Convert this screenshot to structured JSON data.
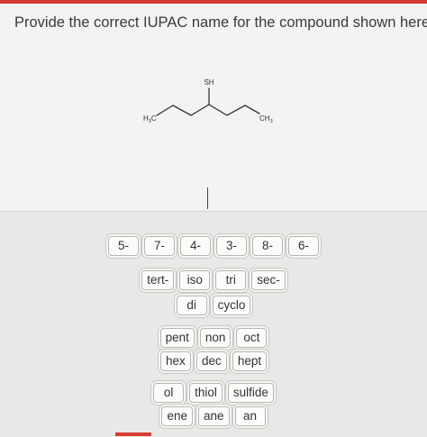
{
  "question": {
    "prompt": "Provide the correct IUPAC name for the compound shown here."
  },
  "molecule": {
    "labels": {
      "thiol_group": "SH",
      "left_terminal": "H",
      "left_terminal_subscript": "3",
      "left_terminal_suffix": "C",
      "right_terminal": "CH",
      "right_terminal_subscript": "3"
    }
  },
  "tiles": {
    "locants": [
      "5-",
      "7-",
      "4-",
      "3-",
      "8-",
      "6-"
    ],
    "prefixes": [
      "tert-",
      "iso",
      "tri",
      "sec-"
    ],
    "modifiers": [
      "di",
      "cyclo"
    ],
    "roots_1": [
      "pent",
      "non",
      "oct"
    ],
    "roots_2": [
      "hex",
      "dec",
      "hept"
    ],
    "suffixes_1": [
      "ol",
      "thiol",
      "sulfide"
    ],
    "suffixes_2": [
      "ene",
      "ane",
      "an"
    ]
  },
  "colors": {
    "accent": "#d63a32",
    "panel_top": "#f4f3f1",
    "panel_bottom": "#e9e8e6"
  }
}
